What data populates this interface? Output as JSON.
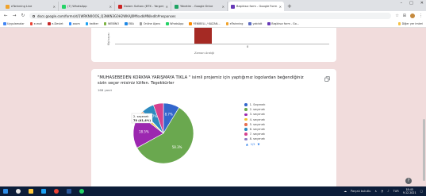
{
  "browser": {
    "tabs": [
      {
        "title": "eTwinning Live",
        "color": "#f0a32b",
        "active": false
      },
      {
        "title": "(7) WhatsApp",
        "color": "#25d366",
        "active": false
      },
      {
        "title": "Dalam Sultanı (BTK - Yargım)",
        "color": "#c22",
        "active": false
      },
      {
        "title": "Yönetim - Google Drive",
        "color": "#1fa463",
        "active": false
      },
      {
        "title": "Başlıksız form - Google Form",
        "color": "#673ab7",
        "active": true
      }
    ],
    "new_tab": "+",
    "url": "docs.google.com/forms/d/1WRKN0OOS_Q3NKN3G0H2WKAJ0MfsxdkMN/edit#responses",
    "bookmarks": [
      {
        "label": "Uygulamalar",
        "color": "#4285f4"
      },
      {
        "label": "e-mail",
        "color": "#ea4335"
      },
      {
        "label": "e-Devlet",
        "color": "#c62828"
      },
      {
        "label": "zoom",
        "color": "#2d8cff"
      },
      {
        "label": "twitter",
        "color": "#1da1f2"
      },
      {
        "label": "WEBİNO",
        "color": "#7cb342"
      },
      {
        "label": "EBA",
        "color": "#1e88e5"
      },
      {
        "label": "Online Ajans",
        "color": "#9e9e9e"
      },
      {
        "label": "WhatsApp",
        "color": "#25d366"
      },
      {
        "label": "YENİBELL / KAZAN...",
        "color": "#fb8c00"
      },
      {
        "label": "eTwinning",
        "color": "#f0a32b"
      },
      {
        "label": "yakıtdt",
        "color": "#5c6bc0"
      },
      {
        "label": "Başlıksız form - Go...",
        "color": "#673ab7"
      }
    ],
    "bookmarks_other": "Diğer yer imleri"
  },
  "form": {
    "prev_chart": {
      "ylabel": "Kişi sayısı",
      "tick": "0",
      "xlabel": "Zaman Aralığı"
    },
    "question": {
      "title": "\"MUHASEBEDEN KORKMA YARIŞMAYA TIKLA \" isimli projemiz için yaptığımız logolardan beğendiğiniz sizin seçer misiniz lütfen. Teşekkürler",
      "responses": "168 yanıt"
    },
    "pager": "1/2"
  },
  "chart_data": {
    "type": "pie",
    "categories": [
      "1. Seçenek",
      "2. seçenek",
      "3. seçenek",
      "4. seçenek",
      "5. seçenek",
      "6. seçenek",
      "7. seçenek",
      "8. seçenek"
    ],
    "values": [
      8.7,
      58.3,
      18.5,
      1.8,
      0.6,
      6.7,
      5.4,
      0.0
    ],
    "colors": [
      "#3366cc",
      "#6aa84f",
      "#9c27b0",
      "#f1c232",
      "#e76f51",
      "#2e8bc0",
      "#d6418f",
      "#8e7cc3"
    ],
    "slice_labels": {
      "0": "8.7%",
      "1": "58.3%",
      "2": "18.5%",
      "5": "6.7%"
    },
    "callout": {
      "label": "2. seçenek",
      "value": "70 (41,4%)"
    }
  },
  "taskbar": {
    "weather": "Parçalı bulutlu",
    "time": "18:45",
    "date": "9.12.2021",
    "lang": "TUR"
  },
  "help": "?"
}
